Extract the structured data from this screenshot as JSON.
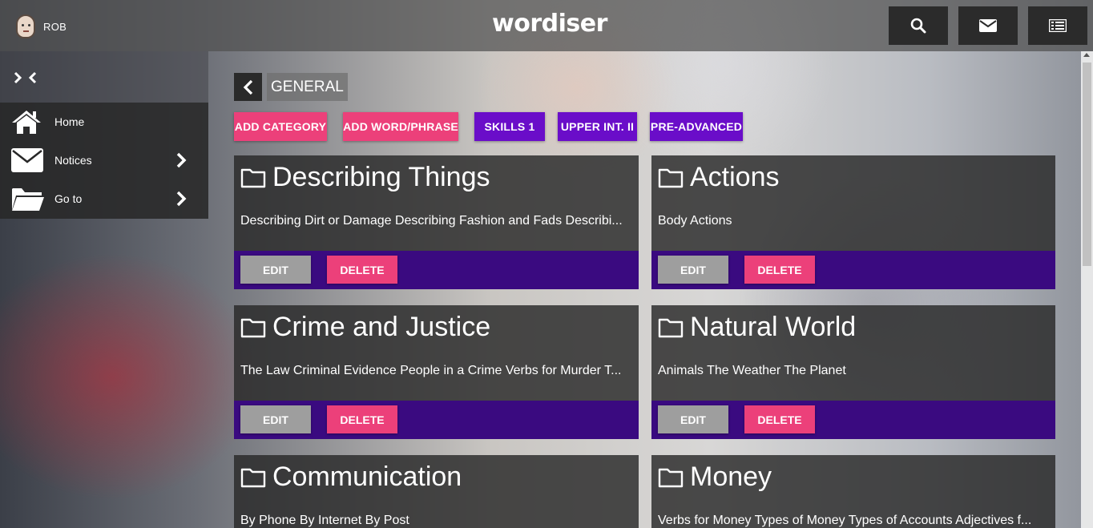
{
  "header": {
    "user_name": "ROB",
    "logo": "wordiser",
    "buttons": [
      {
        "icon": "search-icon"
      },
      {
        "icon": "envelope-icon"
      },
      {
        "icon": "list-icon"
      }
    ]
  },
  "sidebar": {
    "collapse_icon": "collapse-arrows-icon",
    "items": [
      {
        "label": "Home",
        "icon": "home-icon",
        "has_submenu": false
      },
      {
        "label": "Notices",
        "icon": "envelope-icon",
        "has_submenu": true
      },
      {
        "label": "Go to",
        "icon": "folder-open-icon",
        "has_submenu": true
      }
    ]
  },
  "main": {
    "title": "GENERAL",
    "chips": [
      {
        "label": "ADD CATEGORY",
        "color": "#ec407a"
      },
      {
        "label": "ADD WORD/PHRASE",
        "color": "#ec407a"
      },
      {
        "label": "SKILLS 1",
        "color": "#6a0dc9"
      },
      {
        "label": "UPPER INT. II",
        "color": "#6a0dc9"
      },
      {
        "label": "PRE-ADVANCED",
        "color": "#6a0dc9"
      }
    ],
    "edit_label": "EDIT",
    "delete_label": "DELETE",
    "cards": [
      {
        "title": "Describing Things",
        "subs": "Describing Dirt or Damage  Describing Fashion and Fads  Describi..."
      },
      {
        "title": "Actions",
        "subs": "Body Actions"
      },
      {
        "title": "Crime and Justice",
        "subs": "The Law  Criminal Evidence  People in a Crime  Verbs for Murder  T..."
      },
      {
        "title": "Natural World",
        "subs": "Animals  The Weather  The Planet"
      },
      {
        "title": "Communication",
        "subs": "By Phone  By Internet  By Post"
      },
      {
        "title": "Money",
        "subs": "Verbs for Money  Types of Money  Types of Accounts  Adjectives f..."
      }
    ]
  },
  "colors": {
    "accent_pink": "#ec407a",
    "accent_purple": "#6a0dc9",
    "card_action_bar": "#3a0a80"
  }
}
